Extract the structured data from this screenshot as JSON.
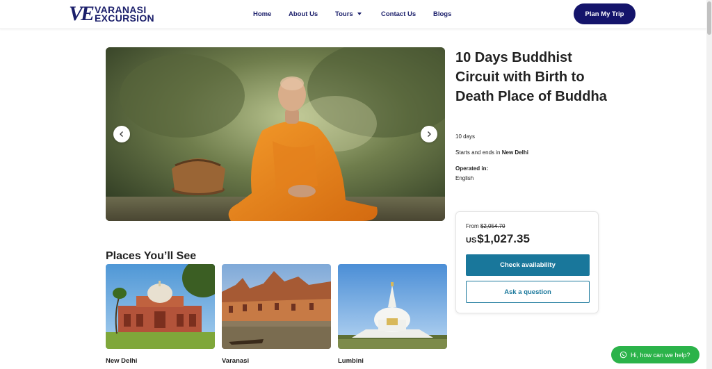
{
  "header": {
    "logo_mark": "VE",
    "logo_line1": "VARANASI",
    "logo_line2": "EXCURSION",
    "nav": [
      {
        "label": "Home"
      },
      {
        "label": "About Us"
      },
      {
        "label": "Tours",
        "has_dropdown": true
      },
      {
        "label": "Contact Us"
      },
      {
        "label": "Blogs"
      }
    ],
    "cta_label": "Plan My Trip"
  },
  "tour": {
    "title": "10 Days Buddhist Circuit with Birth to Death Place of Buddha",
    "duration": "10 days",
    "start_end_prefix": "Starts and ends in ",
    "start_end_city": "New Delhi",
    "operated_label": "Operated in:",
    "operated_value": "English"
  },
  "pricing": {
    "from_label": "From ",
    "original_price": "$2,054.70",
    "currency": "US",
    "price": "$1,027.35",
    "check_label": "Check availability",
    "ask_label": "Ask a question"
  },
  "places": {
    "title": "Places You’ll See",
    "items": [
      {
        "name": "New Delhi"
      },
      {
        "name": "Varanasi"
      },
      {
        "name": "Lumbini"
      }
    ]
  },
  "whatsapp": {
    "label": "Hi, how can we help?"
  },
  "colors": {
    "brand_navy": "#14146b",
    "accent_teal": "#19779b",
    "whatsapp_green": "#2bb34a"
  },
  "icons": {
    "prev": "chevron-left-icon",
    "next": "chevron-right-icon",
    "dropdown": "caret-down-icon",
    "chat": "whatsapp-icon"
  }
}
